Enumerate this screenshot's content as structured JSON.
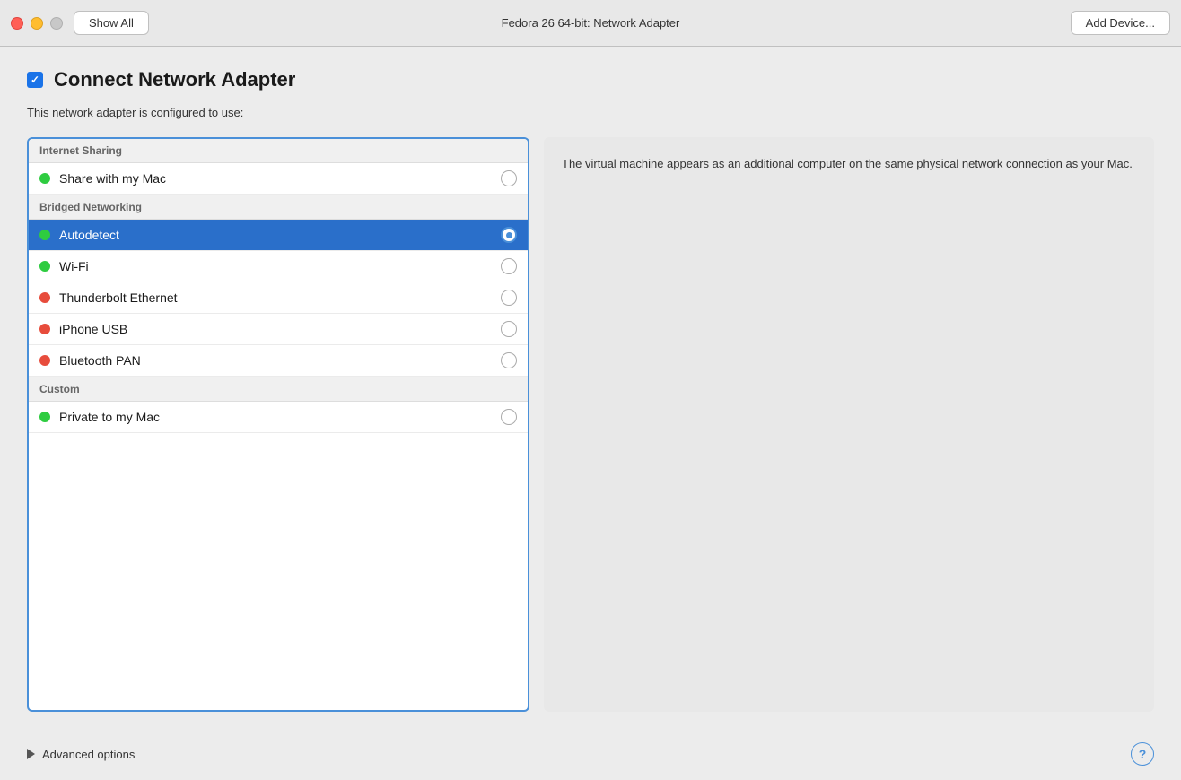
{
  "titlebar": {
    "show_all_label": "Show All",
    "window_title": "Fedora 26 64-bit: Network Adapter",
    "add_device_label": "Add Device..."
  },
  "header": {
    "checkbox_checked": true,
    "title": "Connect Network Adapter",
    "subtitle": "This network adapter is configured to use:"
  },
  "network_sections": [
    {
      "id": "internet-sharing",
      "label": "Internet Sharing",
      "items": [
        {
          "id": "share-mac",
          "label": "Share with my Mac",
          "dot_color": "green",
          "selected": false
        }
      ]
    },
    {
      "id": "bridged-networking",
      "label": "Bridged Networking",
      "items": [
        {
          "id": "autodetect",
          "label": "Autodetect",
          "dot_color": "green",
          "selected": true
        },
        {
          "id": "wifi",
          "label": "Wi-Fi",
          "dot_color": "green",
          "selected": false
        },
        {
          "id": "thunderbolt",
          "label": "Thunderbolt Ethernet",
          "dot_color": "red",
          "selected": false
        },
        {
          "id": "iphone-usb",
          "label": "iPhone USB",
          "dot_color": "red",
          "selected": false
        },
        {
          "id": "bluetooth-pan",
          "label": "Bluetooth PAN",
          "dot_color": "red",
          "selected": false
        }
      ]
    },
    {
      "id": "custom",
      "label": "Custom",
      "items": [
        {
          "id": "private-mac",
          "label": "Private to my Mac",
          "dot_color": "green",
          "selected": false
        }
      ]
    }
  ],
  "info_text": "The virtual machine appears as an additional computer on the same physical network connection as your Mac.",
  "bottom": {
    "advanced_options_label": "Advanced options",
    "help_label": "?"
  },
  "colors": {
    "accent_blue": "#2a6fca",
    "border_blue": "#4a90d9"
  }
}
